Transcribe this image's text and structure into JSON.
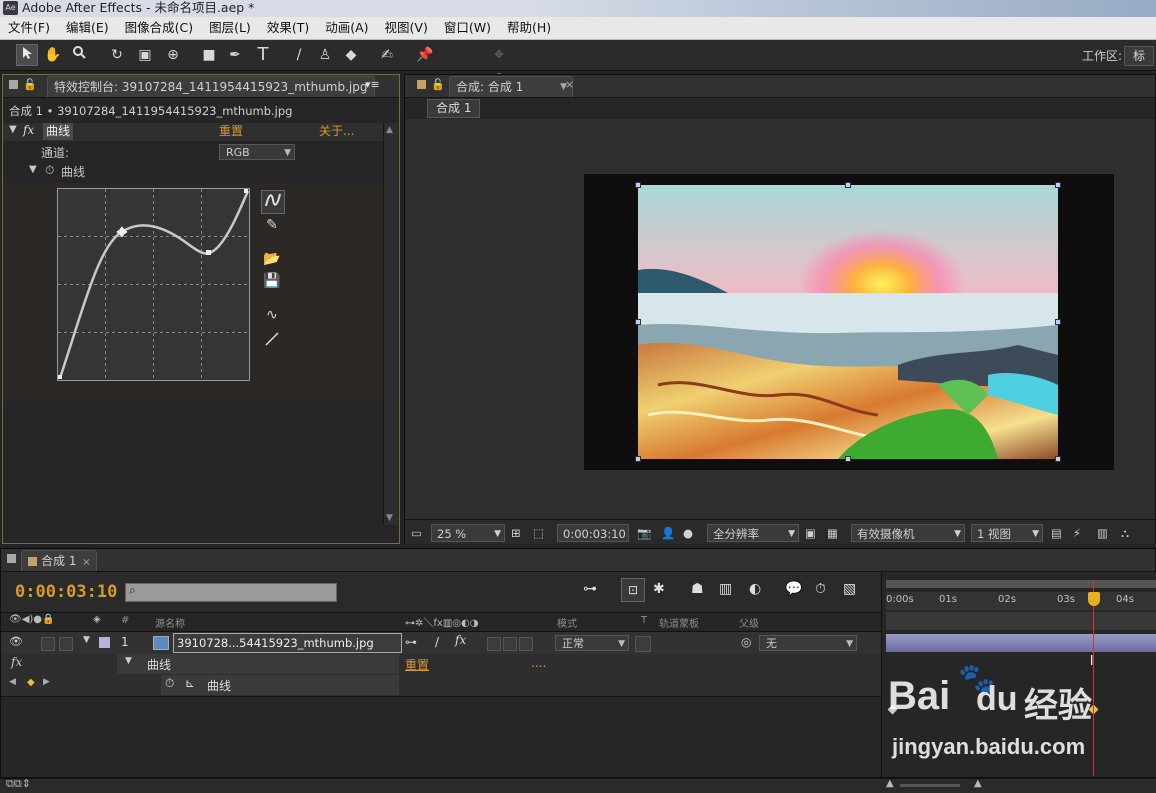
{
  "window": {
    "app_icon": "Ae",
    "title": "Adobe After Effects - 未命名项目.aep *"
  },
  "menu": [
    "文件(F)",
    "编辑(E)",
    "图像合成(C)",
    "图层(L)",
    "效果(T)",
    "动画(A)",
    "视图(V)",
    "窗口(W)",
    "帮助(H)"
  ],
  "toolbar": {
    "tools": [
      "selection-tool-icon",
      "hand-tool-icon",
      "zoom-tool-icon",
      "rotate-tool-icon",
      "camera-orbit-icon",
      "pan-behind-icon",
      "rectangle-tool-icon",
      "pen-tool-icon",
      "text-tool-icon",
      "brush-tool-icon",
      "clone-stamp-icon",
      "eraser-icon",
      "roto-brush-icon",
      "puppet-pin-icon"
    ],
    "workspace_label": "工作区:",
    "workspace_value": "标"
  },
  "effect_controls": {
    "tab_label": "特效控制台: 39107284_1411954415923_mthumb.jpg",
    "breadcrumb": "合成 1 • 39107284_1411954415923_mthumb.jpg",
    "effect_name": "曲线",
    "reset_label": "重置",
    "about_label": "关于...",
    "channel_label": "通道:",
    "channel_value": "RGB",
    "curve_property": "曲线"
  },
  "composition": {
    "tab_label": "合成: 合成 1",
    "subtab_label": "合成 1",
    "zoom": "25 %",
    "timecode": "0:00:03:10",
    "resolution": "全分辨率",
    "camera": "有效摄像机",
    "views": "1 视图"
  },
  "timeline": {
    "tab_label": "合成 1",
    "timecode": "0:00:03:10",
    "search_placeholder": "",
    "columns": {
      "source_name": "源名称",
      "mode": "模式",
      "t": "T",
      "track_matte": "轨道蒙板",
      "parent": "父级",
      "number": "#"
    },
    "layer": {
      "number": "1",
      "name": "3910728...54415923_mthumb.jpg",
      "mode": "正常",
      "parent": "无"
    },
    "effect_row": {
      "fx": "fx",
      "name": "曲线",
      "reset": "重置",
      "dots": "...."
    },
    "property_row": {
      "name": "曲线"
    },
    "ruler_ticks": [
      "0:00s",
      "01s",
      "02s",
      "03s",
      "04s"
    ],
    "playhead_seconds": 3.42
  },
  "watermark": {
    "brand": "Bai",
    "brand2": "du",
    "cn": "经验",
    "url": "jingyan.baidu.com"
  }
}
